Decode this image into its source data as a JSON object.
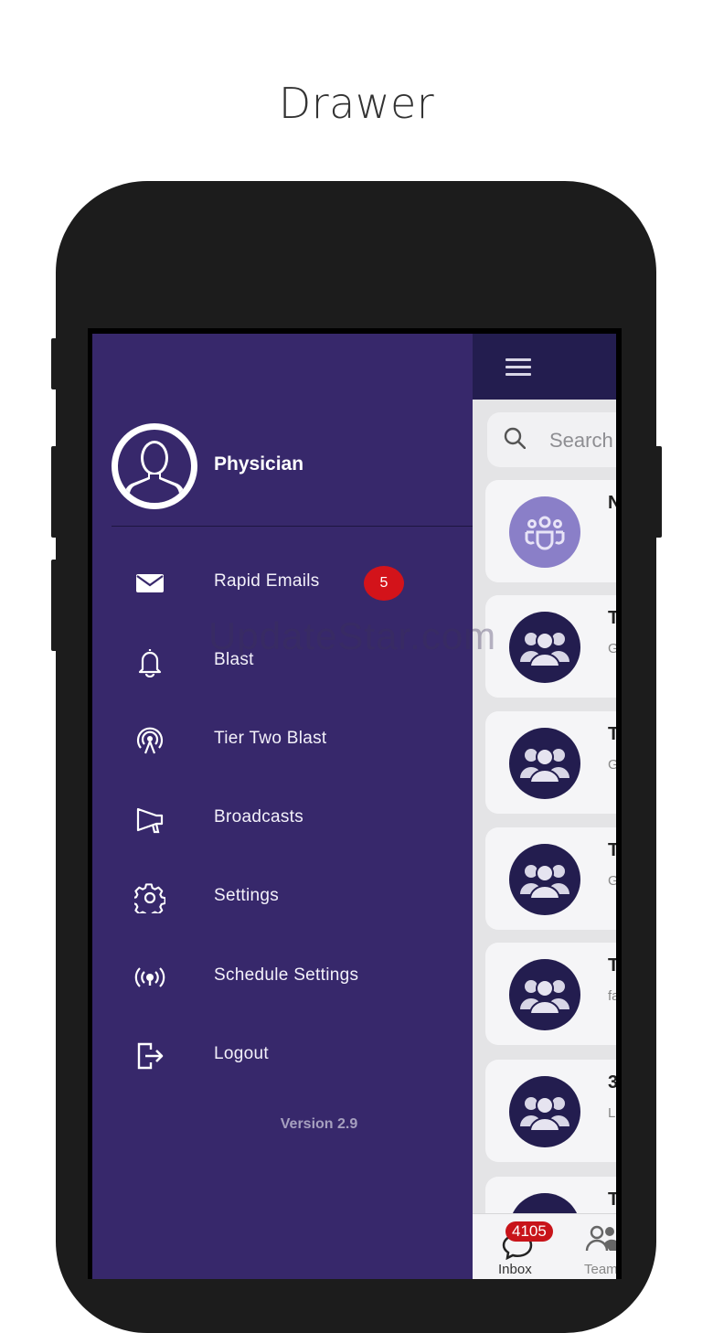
{
  "heading": "Drawer",
  "colors": {
    "drawer_bg": "#37286b",
    "header_bg": "#231d4f",
    "badge_red": "#d3131a",
    "avatar_light": "#8a7fc8"
  },
  "drawer": {
    "profile": {
      "name": "Physician",
      "icon": "person-silhouette-icon"
    },
    "menu": [
      {
        "label": "Rapid Emails",
        "icon": "envelope-icon",
        "badge": "5"
      },
      {
        "label": "Blast",
        "icon": "bell-icon"
      },
      {
        "label": "Tier Two Blast",
        "icon": "broadcast-tower-icon"
      },
      {
        "label": "Broadcasts",
        "icon": "megaphone-icon"
      },
      {
        "label": "Settings",
        "icon": "gear-icon"
      },
      {
        "label": "Schedule Settings",
        "icon": "radio-waves-icon"
      },
      {
        "label": "Logout",
        "icon": "logout-icon"
      }
    ],
    "version": "Version 2.9"
  },
  "background_app": {
    "search_placeholder": "Search",
    "cards": [
      {
        "title": "N",
        "subtitle": ""
      },
      {
        "title": "T",
        "subtitle": "G"
      },
      {
        "title": "T",
        "subtitle": "G"
      },
      {
        "title": "T",
        "subtitle": "G"
      },
      {
        "title": "T",
        "subtitle": "fa"
      },
      {
        "title": "3",
        "subtitle": "L"
      },
      {
        "title": "T",
        "subtitle": ""
      }
    ],
    "tabs": [
      {
        "label": "Inbox",
        "badge": "4105",
        "icon": "chat-bubble-icon"
      },
      {
        "label": "Team",
        "icon": "people-icon"
      }
    ]
  },
  "watermark": "UpdateStar.com"
}
